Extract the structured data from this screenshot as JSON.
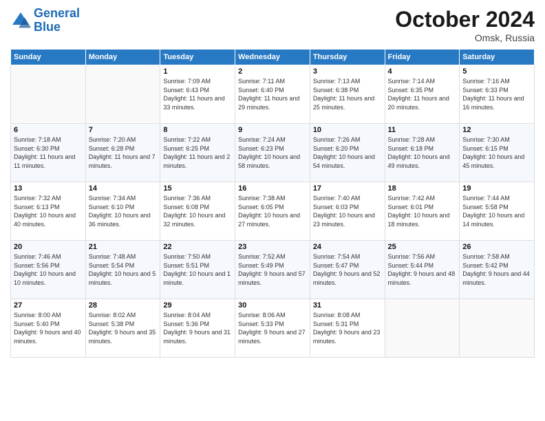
{
  "header": {
    "logo_line1": "General",
    "logo_line2": "Blue",
    "month": "October 2024",
    "location": "Omsk, Russia"
  },
  "days_of_week": [
    "Sunday",
    "Monday",
    "Tuesday",
    "Wednesday",
    "Thursday",
    "Friday",
    "Saturday"
  ],
  "weeks": [
    [
      {
        "day": "",
        "sunrise": "",
        "sunset": "",
        "daylight": ""
      },
      {
        "day": "",
        "sunrise": "",
        "sunset": "",
        "daylight": ""
      },
      {
        "day": "1",
        "sunrise": "Sunrise: 7:09 AM",
        "sunset": "Sunset: 6:43 PM",
        "daylight": "Daylight: 11 hours and 33 minutes."
      },
      {
        "day": "2",
        "sunrise": "Sunrise: 7:11 AM",
        "sunset": "Sunset: 6:40 PM",
        "daylight": "Daylight: 11 hours and 29 minutes."
      },
      {
        "day": "3",
        "sunrise": "Sunrise: 7:13 AM",
        "sunset": "Sunset: 6:38 PM",
        "daylight": "Daylight: 11 hours and 25 minutes."
      },
      {
        "day": "4",
        "sunrise": "Sunrise: 7:14 AM",
        "sunset": "Sunset: 6:35 PM",
        "daylight": "Daylight: 11 hours and 20 minutes."
      },
      {
        "day": "5",
        "sunrise": "Sunrise: 7:16 AM",
        "sunset": "Sunset: 6:33 PM",
        "daylight": "Daylight: 11 hours and 16 minutes."
      }
    ],
    [
      {
        "day": "6",
        "sunrise": "Sunrise: 7:18 AM",
        "sunset": "Sunset: 6:30 PM",
        "daylight": "Daylight: 11 hours and 11 minutes."
      },
      {
        "day": "7",
        "sunrise": "Sunrise: 7:20 AM",
        "sunset": "Sunset: 6:28 PM",
        "daylight": "Daylight: 11 hours and 7 minutes."
      },
      {
        "day": "8",
        "sunrise": "Sunrise: 7:22 AM",
        "sunset": "Sunset: 6:25 PM",
        "daylight": "Daylight: 11 hours and 2 minutes."
      },
      {
        "day": "9",
        "sunrise": "Sunrise: 7:24 AM",
        "sunset": "Sunset: 6:23 PM",
        "daylight": "Daylight: 10 hours and 58 minutes."
      },
      {
        "day": "10",
        "sunrise": "Sunrise: 7:26 AM",
        "sunset": "Sunset: 6:20 PM",
        "daylight": "Daylight: 10 hours and 54 minutes."
      },
      {
        "day": "11",
        "sunrise": "Sunrise: 7:28 AM",
        "sunset": "Sunset: 6:18 PM",
        "daylight": "Daylight: 10 hours and 49 minutes."
      },
      {
        "day": "12",
        "sunrise": "Sunrise: 7:30 AM",
        "sunset": "Sunset: 6:15 PM",
        "daylight": "Daylight: 10 hours and 45 minutes."
      }
    ],
    [
      {
        "day": "13",
        "sunrise": "Sunrise: 7:32 AM",
        "sunset": "Sunset: 6:13 PM",
        "daylight": "Daylight: 10 hours and 40 minutes."
      },
      {
        "day": "14",
        "sunrise": "Sunrise: 7:34 AM",
        "sunset": "Sunset: 6:10 PM",
        "daylight": "Daylight: 10 hours and 36 minutes."
      },
      {
        "day": "15",
        "sunrise": "Sunrise: 7:36 AM",
        "sunset": "Sunset: 6:08 PM",
        "daylight": "Daylight: 10 hours and 32 minutes."
      },
      {
        "day": "16",
        "sunrise": "Sunrise: 7:38 AM",
        "sunset": "Sunset: 6:05 PM",
        "daylight": "Daylight: 10 hours and 27 minutes."
      },
      {
        "day": "17",
        "sunrise": "Sunrise: 7:40 AM",
        "sunset": "Sunset: 6:03 PM",
        "daylight": "Daylight: 10 hours and 23 minutes."
      },
      {
        "day": "18",
        "sunrise": "Sunrise: 7:42 AM",
        "sunset": "Sunset: 6:01 PM",
        "daylight": "Daylight: 10 hours and 18 minutes."
      },
      {
        "day": "19",
        "sunrise": "Sunrise: 7:44 AM",
        "sunset": "Sunset: 5:58 PM",
        "daylight": "Daylight: 10 hours and 14 minutes."
      }
    ],
    [
      {
        "day": "20",
        "sunrise": "Sunrise: 7:46 AM",
        "sunset": "Sunset: 5:56 PM",
        "daylight": "Daylight: 10 hours and 10 minutes."
      },
      {
        "day": "21",
        "sunrise": "Sunrise: 7:48 AM",
        "sunset": "Sunset: 5:54 PM",
        "daylight": "Daylight: 10 hours and 5 minutes."
      },
      {
        "day": "22",
        "sunrise": "Sunrise: 7:50 AM",
        "sunset": "Sunset: 5:51 PM",
        "daylight": "Daylight: 10 hours and 1 minute."
      },
      {
        "day": "23",
        "sunrise": "Sunrise: 7:52 AM",
        "sunset": "Sunset: 5:49 PM",
        "daylight": "Daylight: 9 hours and 57 minutes."
      },
      {
        "day": "24",
        "sunrise": "Sunrise: 7:54 AM",
        "sunset": "Sunset: 5:47 PM",
        "daylight": "Daylight: 9 hours and 52 minutes."
      },
      {
        "day": "25",
        "sunrise": "Sunrise: 7:56 AM",
        "sunset": "Sunset: 5:44 PM",
        "daylight": "Daylight: 9 hours and 48 minutes."
      },
      {
        "day": "26",
        "sunrise": "Sunrise: 7:58 AM",
        "sunset": "Sunset: 5:42 PM",
        "daylight": "Daylight: 9 hours and 44 minutes."
      }
    ],
    [
      {
        "day": "27",
        "sunrise": "Sunrise: 8:00 AM",
        "sunset": "Sunset: 5:40 PM",
        "daylight": "Daylight: 9 hours and 40 minutes."
      },
      {
        "day": "28",
        "sunrise": "Sunrise: 8:02 AM",
        "sunset": "Sunset: 5:38 PM",
        "daylight": "Daylight: 9 hours and 35 minutes."
      },
      {
        "day": "29",
        "sunrise": "Sunrise: 8:04 AM",
        "sunset": "Sunset: 5:36 PM",
        "daylight": "Daylight: 9 hours and 31 minutes."
      },
      {
        "day": "30",
        "sunrise": "Sunrise: 8:06 AM",
        "sunset": "Sunset: 5:33 PM",
        "daylight": "Daylight: 9 hours and 27 minutes."
      },
      {
        "day": "31",
        "sunrise": "Sunrise: 8:08 AM",
        "sunset": "Sunset: 5:31 PM",
        "daylight": "Daylight: 9 hours and 23 minutes."
      },
      {
        "day": "",
        "sunrise": "",
        "sunset": "",
        "daylight": ""
      },
      {
        "day": "",
        "sunrise": "",
        "sunset": "",
        "daylight": ""
      }
    ]
  ]
}
